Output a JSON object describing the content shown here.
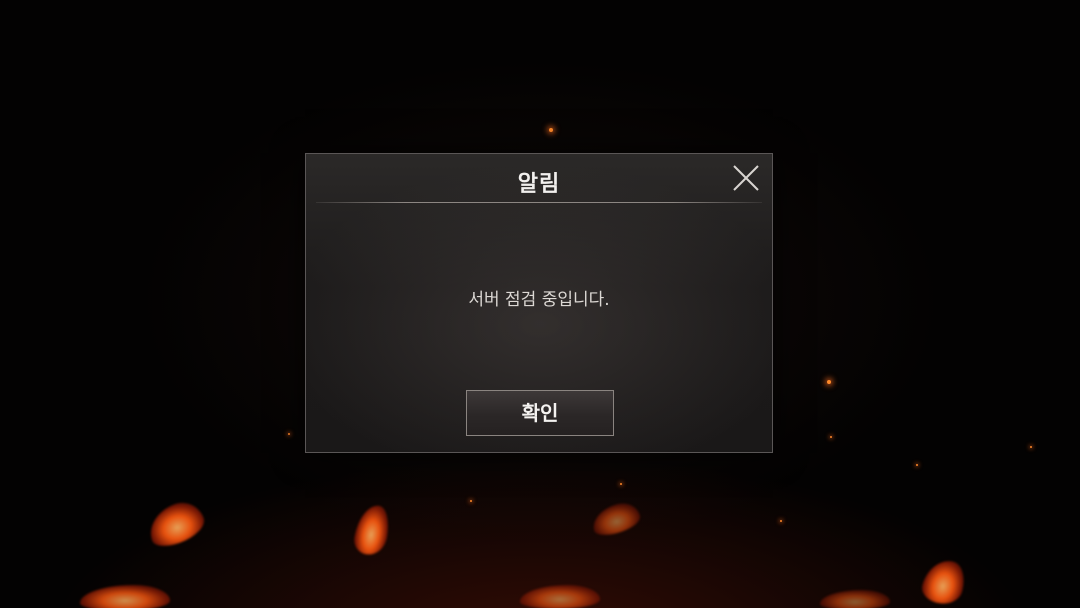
{
  "dialog": {
    "title": "알림",
    "message": "서버 점검 중입니다.",
    "confirm_label": "확인",
    "close_icon": "close-icon"
  },
  "colors": {
    "background": "#030202",
    "panel": "#221f1e",
    "panel_border": "#5a5656",
    "text": "#f2f0ee",
    "ember": "#ff8a2a"
  }
}
